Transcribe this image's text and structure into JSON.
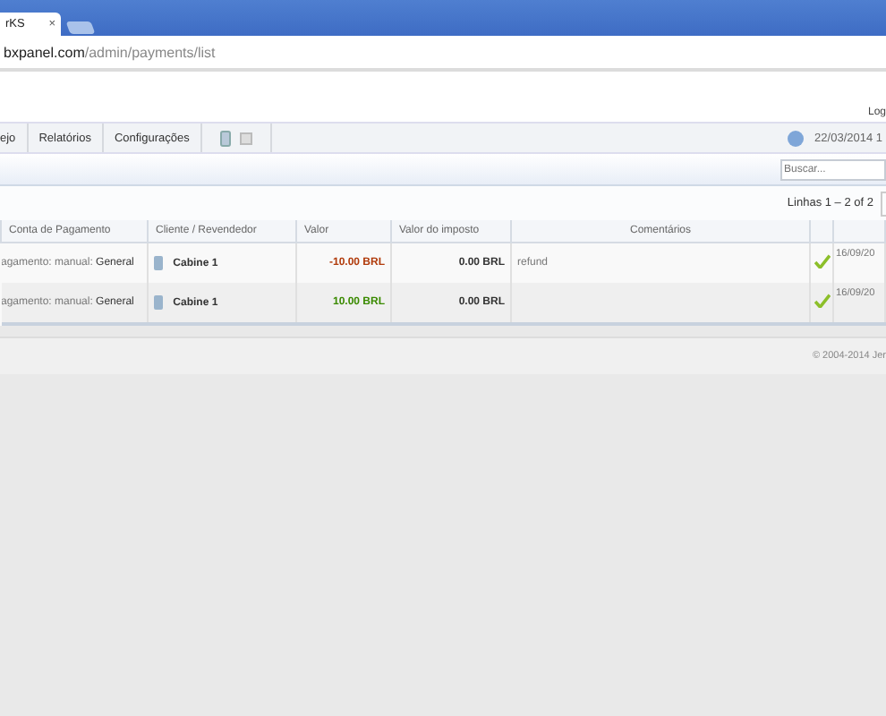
{
  "browser": {
    "tab_title": "rKS",
    "tab_close": "×",
    "url_host": "bxpanel.com",
    "url_path": "/admin/payments/list"
  },
  "header": {
    "logout": "Log"
  },
  "nav": {
    "items": [
      "ejo",
      "Relatórios",
      "Configurações"
    ],
    "date": "22/03/2014 1"
  },
  "search": {
    "placeholder": "Buscar..."
  },
  "pager": {
    "label": "Linhas",
    "range": "1 – 2 of 2"
  },
  "table": {
    "columns": [
      "Conta de Pagamento",
      "Cliente / Revendedor",
      "Valor",
      "Valor do imposto",
      "Comentários"
    ],
    "rows": [
      {
        "account_prefix": "agamento: manual:",
        "account_name": "General",
        "client": "Cabine 1",
        "value": "-10.00 BRL",
        "kind": "debit",
        "tax": "0.00 BRL",
        "comment": "refund",
        "confirmed": true,
        "date": "16/09/20"
      },
      {
        "account_prefix": "agamento: manual:",
        "account_name": "General",
        "client": "Cabine 1",
        "value": "10.00 BRL",
        "kind": "credit",
        "tax": "0.00 BRL",
        "comment": "",
        "confirmed": true,
        "date": "16/09/20"
      }
    ]
  },
  "footer": {
    "copyright": "© 2004-2014 Jer"
  }
}
